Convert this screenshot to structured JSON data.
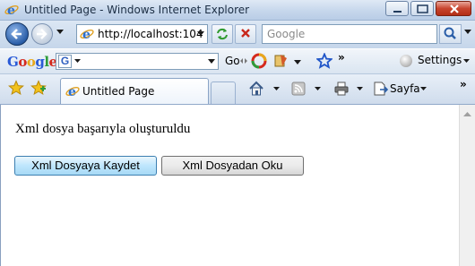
{
  "window": {
    "title": "Untitled Page - Windows Internet Explorer"
  },
  "address_bar": {
    "url": "http://localhost:104"
  },
  "search": {
    "placeholder": "Google"
  },
  "google_toolbar": {
    "logo": "Google",
    "go_label": "Go",
    "settings_label": "Settings"
  },
  "tab": {
    "title": "Untitled Page"
  },
  "command_bar": {
    "page_label": "Sayfa"
  },
  "content": {
    "message": "Xml dosya başarıyla oluşturuldu",
    "save_button": "Xml Dosyaya Kaydet",
    "read_button": "Xml Dosyadan Oku"
  }
}
